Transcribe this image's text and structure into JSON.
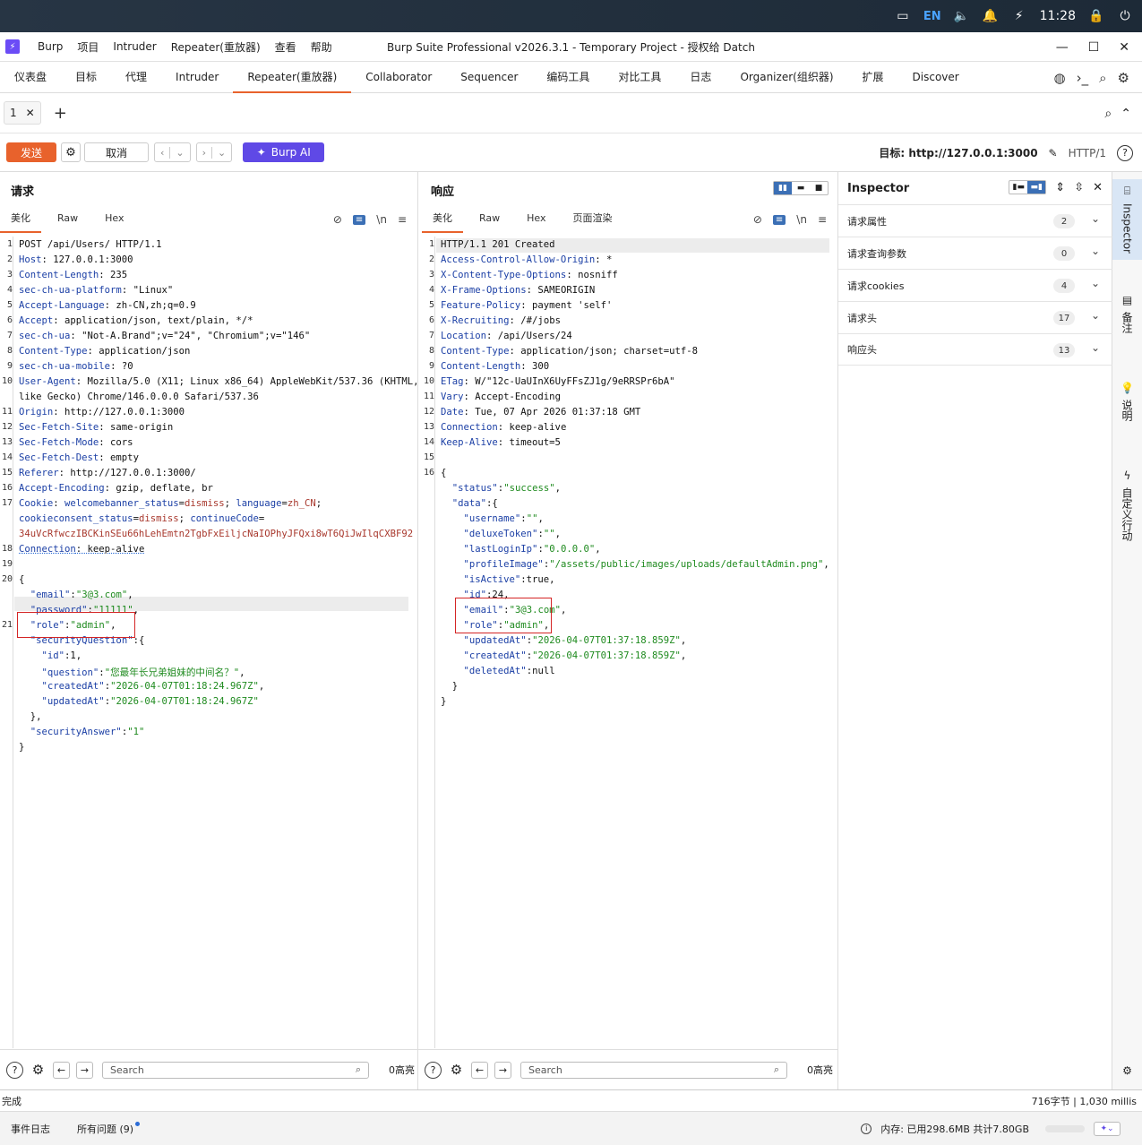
{
  "system": {
    "lang": "EN",
    "time": "11:28"
  },
  "titlebar": {
    "menu": [
      "Burp",
      "项目",
      "Intruder",
      "Repeater(重放器)",
      "查看",
      "帮助"
    ],
    "title": "Burp Suite Professional v2026.3.1 - Temporary Project - 授权给 Datch"
  },
  "main_tabs": [
    "仪表盘",
    "目标",
    "代理",
    "Intruder",
    "Repeater(重放器)",
    "Collaborator",
    "Sequencer",
    "编码工具",
    "对比工具",
    "日志",
    "Organizer(组织器)",
    "扩展",
    "Discover"
  ],
  "active_main_tab": "Repeater(重放器)",
  "sub_tab": {
    "label": "1"
  },
  "toolbar": {
    "send": "发送",
    "cancel": "取消",
    "burpai": "Burp AI",
    "target": "目标: http://127.0.0.1:3000",
    "http": "HTTP/1"
  },
  "request": {
    "title": "请求",
    "tabs": [
      "美化",
      "Raw",
      "Hex"
    ],
    "search_placeholder": "Search",
    "highlights": "0高亮"
  },
  "response": {
    "title": "响应",
    "tabs": [
      "美化",
      "Raw",
      "Hex",
      "页面渲染"
    ],
    "search_placeholder": "Search",
    "highlights": "0高亮"
  },
  "inspector": {
    "title": "Inspector",
    "rows": [
      {
        "label": "请求属性",
        "count": "2"
      },
      {
        "label": "请求查询参数",
        "count": "0"
      },
      {
        "label": "请求cookies",
        "count": "4"
      },
      {
        "label": "请求头",
        "count": "17"
      },
      {
        "label": "响应头",
        "count": "13"
      }
    ]
  },
  "sidebar": [
    "Inspector",
    "备注",
    "说明",
    "自定义行动"
  ],
  "status": {
    "left": "完成",
    "right": "716字节 | 1,030 millis"
  },
  "bottom": {
    "event_log": "事件日志",
    "issues": "所有问题 (9)",
    "memory": "内存: 已用298.6MB 共计7.80GB"
  }
}
